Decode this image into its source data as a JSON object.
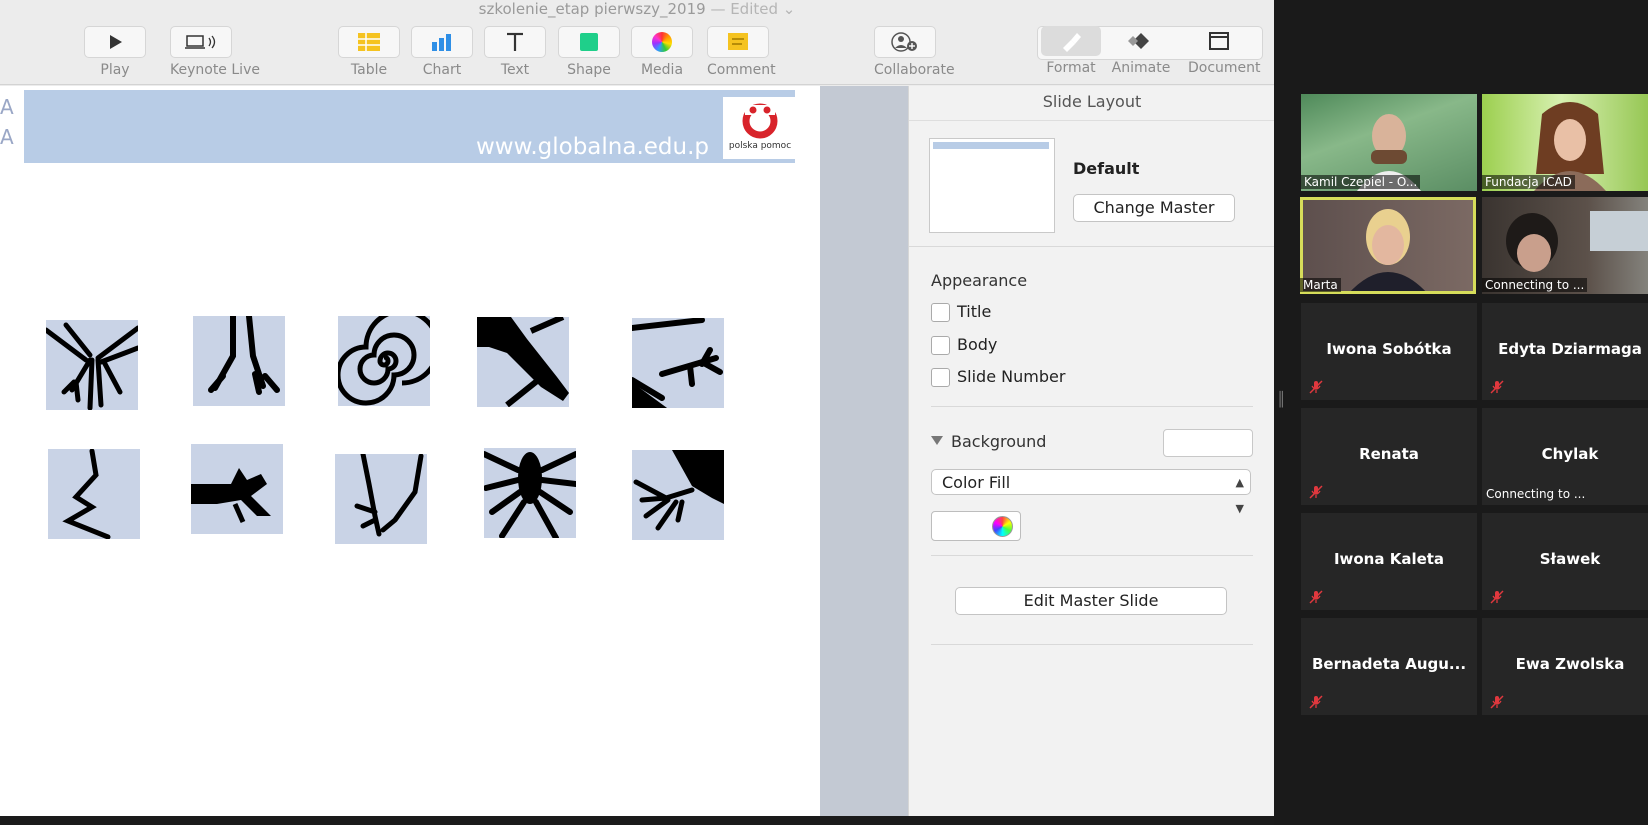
{
  "window": {
    "title": "szkolenie_etap pierwszy_2019",
    "status": "— Edited ⌄"
  },
  "toolbar": {
    "play": "Play",
    "keynote_live": "Keynote Live",
    "table": "Table",
    "chart": "Chart",
    "text": "Text",
    "shape": "Shape",
    "media": "Media",
    "comment": "Comment",
    "collaborate": "Collaborate",
    "format": "Format",
    "animate": "Animate",
    "document": "Document"
  },
  "slide": {
    "url": "www.globalna.edu.p",
    "logo_text": "polska pomoc",
    "left_marks": "A\nA",
    "glyphs": [
      "figure-1",
      "figure-2",
      "spiral",
      "figure-4",
      "figure-5",
      "zigzag",
      "figure-7",
      "figure-8",
      "spider",
      "hand"
    ]
  },
  "inspector": {
    "title": "Slide Layout",
    "master_name": "Default",
    "change_master": "Change Master",
    "appearance": "Appearance",
    "checkboxes": [
      {
        "label": "Title",
        "checked": false
      },
      {
        "label": "Body",
        "checked": false
      },
      {
        "label": "Slide Number",
        "checked": false
      }
    ],
    "background": "Background",
    "fill_type": "Color Fill",
    "edit_master": "Edit Master Slide"
  },
  "zoom": {
    "participants": [
      {
        "name": "Kamil Czepiel - O...",
        "video": true
      },
      {
        "name": "Fundacja ICAD",
        "video": true
      },
      {
        "name": "Marta",
        "video": true,
        "active": true
      },
      {
        "name": "Connecting to ...",
        "video": true
      },
      {
        "name": "Iwona Sobótka",
        "muted": true
      },
      {
        "name": "Edyta Dziarmaga",
        "muted": true
      },
      {
        "name": "Renata",
        "muted": true
      },
      {
        "name": "Chylak",
        "status": "Connecting to ..."
      },
      {
        "name": "Iwona Kaleta",
        "muted": true
      },
      {
        "name": "Sławek",
        "muted": true
      },
      {
        "name": "Bernadeta  Augu...",
        "muted": true
      },
      {
        "name": "Ewa Zwolska",
        "muted": true
      }
    ]
  },
  "colors": {
    "slide_header": "#b8cce6",
    "glyph_bg": "#c9d3e6",
    "active_speaker": "#d6dd5a",
    "mute_red": "#e0383e"
  }
}
